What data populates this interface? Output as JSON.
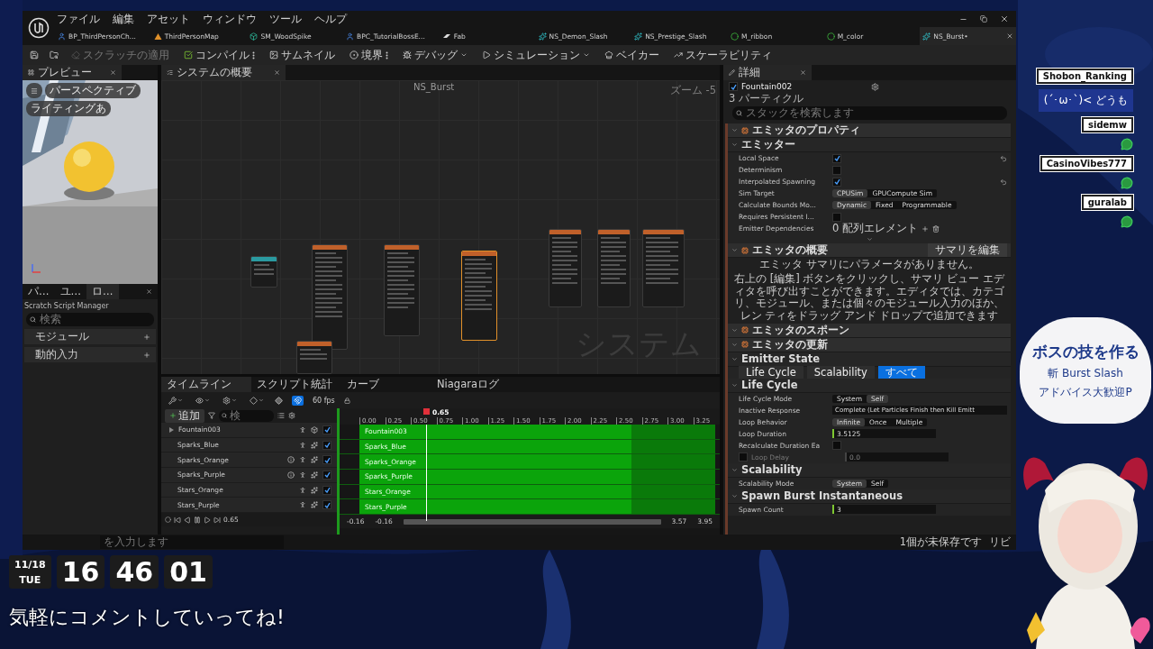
{
  "menu": [
    "ファイル",
    "編集",
    "アセット",
    "ウィンドウ",
    "ツール",
    "ヘルプ"
  ],
  "asset_tabs": [
    {
      "label": "BP_ThirdPersonCh...",
      "kind": "blueprint",
      "selected": false
    },
    {
      "label": "ThirdPersonMap",
      "kind": "level",
      "selected": false
    },
    {
      "label": "SM_WoodSpike",
      "kind": "mesh",
      "selected": false
    },
    {
      "label": "BPC_TutorialBossE...",
      "kind": "blueprint",
      "selected": false
    },
    {
      "label": "Fab",
      "kind": "fab",
      "selected": false
    },
    {
      "label": "NS_Demon_Slash",
      "kind": "niagara",
      "selected": false
    },
    {
      "label": "NS_Prestige_Slash",
      "kind": "niagara",
      "selected": false
    },
    {
      "label": "M_ribbon",
      "kind": "material",
      "selected": false
    },
    {
      "label": "M_color",
      "kind": "material",
      "selected": false
    },
    {
      "label": "NS_Burst•",
      "kind": "niagara",
      "selected": true
    }
  ],
  "toolbar": [
    {
      "label": "スクラッチの適用",
      "kind": "plain",
      "disabled": true
    },
    {
      "label": "コンパイル",
      "kind": "options",
      "disabled": false
    },
    {
      "label": "サムネイル",
      "kind": "plain",
      "disabled": false
    },
    {
      "label": "境界",
      "kind": "options",
      "disabled": false
    },
    {
      "label": "デバッグ",
      "kind": "dropdown",
      "disabled": false
    },
    {
      "label": "シミュレーション",
      "kind": "dropdown",
      "disabled": false
    },
    {
      "label": "ベイカー",
      "kind": "plain",
      "disabled": false
    },
    {
      "label": "スケーラビリティ",
      "kind": "plain",
      "disabled": false
    }
  ],
  "preview": {
    "tab": "プレビュー",
    "chips": [
      "パースペクティブ",
      "ライティングあ"
    ]
  },
  "side_tabs": [
    {
      "label": "パ…",
      "selected": false
    },
    {
      "label": "ユ…",
      "selected": false
    },
    {
      "label": "ロ…",
      "selected": true
    }
  ],
  "scratch": {
    "title": "Scratch Script Manager",
    "search": {
      "placeholder": "検索"
    },
    "items": [
      "モジュール",
      "動的入力"
    ]
  },
  "graph": {
    "tab": "システムの概要",
    "title": "NS_Burst",
    "zoom": "ズーム -5",
    "watermark": "システム",
    "nodes": [
      {
        "selected": false
      },
      {
        "selected": false
      },
      {
        "selected": false
      },
      {
        "selected": true
      },
      {
        "selected": false
      },
      {
        "selected": false
      },
      {
        "selected": false
      },
      {
        "selected": false
      }
    ]
  },
  "timeline": {
    "tabs": [
      {
        "label": "タイムライン",
        "selected": true
      },
      {
        "label": "スクリプト統計",
        "selected": false
      },
      {
        "label": "カーブ",
        "selected": false
      },
      {
        "label": "Niagaraログ",
        "selected": false
      }
    ],
    "fps": "60 fps",
    "snap": true,
    "add": "追加",
    "filter": {
      "placeholder": "検"
    },
    "ticks": [
      "0.00",
      "0.25",
      "0.50",
      "0.75",
      "1.00",
      "1.25",
      "1.50",
      "1.75",
      "2.00",
      "2.25",
      "2.50",
      "2.75",
      "3.00",
      "3.25"
    ],
    "playhead": "0.65",
    "rows": [
      {
        "name": "Fountain003",
        "kind": "group",
        "info": false,
        "enabled": true,
        "track_label": "Fountain003"
      },
      {
        "name": "Sparks_Blue",
        "kind": "emitter",
        "info": false,
        "enabled": true,
        "track_label": "Sparks_Blue"
      },
      {
        "name": "Sparks_Orange",
        "kind": "emitter",
        "info": true,
        "enabled": true,
        "track_label": "Sparks_Orange"
      },
      {
        "name": "Sparks_Purple",
        "kind": "emitter",
        "info": true,
        "enabled": true,
        "track_label": "Sparks_Purple"
      },
      {
        "name": "Stars_Orange",
        "kind": "emitter",
        "info": false,
        "enabled": true,
        "track_label": "Stars_Orange"
      },
      {
        "name": "Stars_Purple",
        "kind": "emitter",
        "info": false,
        "enabled": true,
        "track_label": "Stars_Purple"
      }
    ],
    "current_time": "0.65",
    "range": [
      "-0.16",
      "-0.16",
      "3.57",
      "3.95"
    ]
  },
  "details": {
    "tab": "詳細",
    "emitter": "Fountain002",
    "enabled": true,
    "count": "3 パーティクル",
    "search": {
      "placeholder": "スタックを検索します"
    },
    "items": [
      {
        "kind": "section",
        "title": "エミッタのプロパティ"
      },
      {
        "kind": "subsection",
        "title": "エミッター"
      },
      {
        "kind": "checkbox",
        "label": "Local Space",
        "checked": true,
        "reset": true
      },
      {
        "kind": "checkbox",
        "label": "Determinism",
        "checked": false,
        "reset": false
      },
      {
        "kind": "checkbox",
        "label": "Interpolated Spawning",
        "checked": true,
        "reset": true
      },
      {
        "kind": "segmented",
        "label": "Sim Target",
        "options": [
          {
            "label": "CPUSim",
            "selected": true
          },
          {
            "label": "GPUCompute Sim",
            "selected": false
          }
        ]
      },
      {
        "kind": "segmented",
        "label": "Calculate Bounds Mo...",
        "options": [
          {
            "label": "Dynamic",
            "selected": true
          },
          {
            "label": "Fixed",
            "selected": false
          },
          {
            "label": "Programmable",
            "selected": false
          }
        ]
      },
      {
        "kind": "checkbox",
        "label": "Requires Persistent I...",
        "checked": false,
        "reset": false
      },
      {
        "kind": "array",
        "label": "Emitter Dependencies",
        "value": "0 配列エレメント"
      },
      {
        "kind": "more"
      },
      {
        "kind": "section",
        "title": "エミッタの概要",
        "button": "サマリを編集"
      },
      {
        "kind": "note",
        "text": "エミッタ サマリにパラメータがありません。"
      },
      {
        "kind": "note",
        "text": "右上の [編集] ボタンをクリックし、サマリ ビュー エディタを呼び出すことができます。エディタでは、カテゴリ、モジュール、または個々のモジュール入力のほか、レン ティをドラッグ アンド ドロップで追加できます"
      },
      {
        "kind": "section",
        "title": "エミッタのスポーン"
      },
      {
        "kind": "section",
        "title": "エミッタの更新"
      },
      {
        "kind": "subsection",
        "title": "Emitter State"
      },
      {
        "kind": "tabs",
        "options": [
          {
            "label": "Life Cycle",
            "selected": false
          },
          {
            "label": "Scalability",
            "selected": false
          },
          {
            "label": "すべて",
            "selected": true
          }
        ]
      },
      {
        "kind": "subsection",
        "title": "Life Cycle"
      },
      {
        "kind": "segmented",
        "label": "Life Cycle Mode",
        "options": [
          {
            "label": "System",
            "selected": false
          },
          {
            "label": "Self",
            "selected": true
          }
        ]
      },
      {
        "kind": "dropdown",
        "label": "Inactive Response",
        "value": "Complete (Let Particles Finish then Kill Emitt"
      },
      {
        "kind": "segmented",
        "label": "Loop Behavior",
        "options": [
          {
            "label": "Infinite",
            "selected": true
          },
          {
            "label": "Once",
            "selected": false
          },
          {
            "label": "Multiple",
            "selected": false
          }
        ]
      },
      {
        "kind": "number",
        "label": "Loop Duration",
        "value": "3.5125"
      },
      {
        "kind": "checkbox",
        "label": "Recalculate Duration Ea",
        "checked": false,
        "reset": false
      },
      {
        "kind": "toggle-number",
        "label": "Loop Delay",
        "value": "0.0",
        "checked": false
      },
      {
        "kind": "subsection",
        "title": "Scalability"
      },
      {
        "kind": "segmented",
        "label": "Scalability Mode",
        "options": [
          {
            "label": "System",
            "selected": true
          },
          {
            "label": "Self",
            "selected": false
          }
        ]
      },
      {
        "kind": "subsection",
        "title": "Spawn Burst Instantaneous"
      },
      {
        "kind": "number",
        "label": "Spawn Count",
        "value": "3"
      }
    ]
  },
  "status_bar": {
    "console": {
      "placeholder": "を入力します"
    },
    "unsaved": "1個が未保存です",
    "revision": "リビ"
  },
  "overlay": {
    "chat": [
      {
        "kind": "message",
        "name": "Shobon_Ranking",
        "text": "(´･ω･`)< どうも"
      },
      {
        "kind": "name",
        "name": "sidemw"
      },
      {
        "kind": "name",
        "name": "CasinoVibes777"
      },
      {
        "kind": "name",
        "name": "guralab"
      }
    ],
    "whiteboard": [
      "ボスの技を作る",
      "斬 Burst Slash",
      "アドバイス大歓迎P"
    ],
    "clock": {
      "date": "11/18",
      "weekday": "TUE",
      "digits": [
        "16",
        "46",
        "01"
      ]
    },
    "caption": "気軽にコメントしていってね!"
  }
}
